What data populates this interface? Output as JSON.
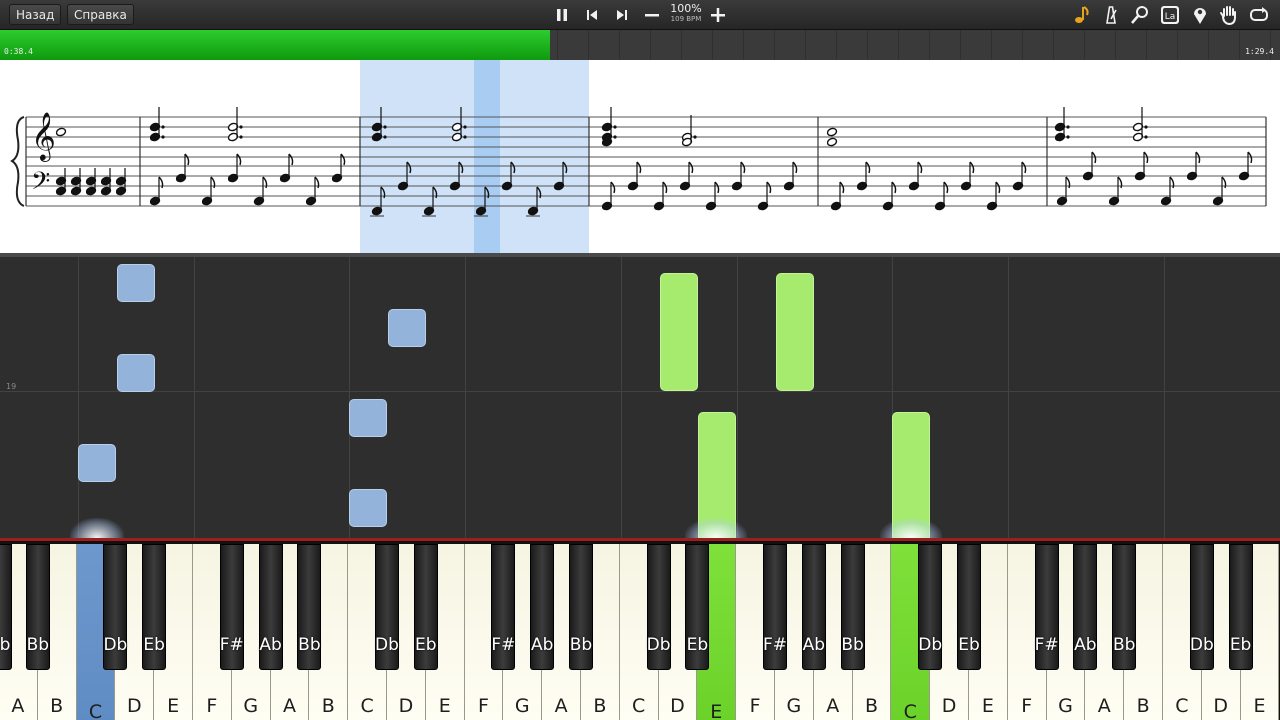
{
  "toolbar": {
    "back_label": "Назад",
    "help_label": "Справка",
    "zoom": "100%",
    "tempo": "109 BPM"
  },
  "progress": {
    "current_time": "0:38.4",
    "total_time": "1:29.4",
    "fraction": 0.43
  },
  "roll": {
    "measure_number": "19"
  },
  "keyboard": {
    "white_keys": [
      "A",
      "B",
      "C",
      "D",
      "E",
      "F",
      "G",
      "A",
      "B",
      "C",
      "D",
      "E",
      "F",
      "G",
      "A",
      "B",
      "C",
      "D",
      "E",
      "F",
      "G",
      "A",
      "B",
      "C",
      "D",
      "E",
      "F",
      "G",
      "A",
      "B",
      "C",
      "D",
      "E"
    ],
    "black_keys": [
      "Bb",
      "Db",
      "Eb",
      "F#",
      "Ab",
      "Bb",
      "Db",
      "Eb",
      "F#",
      "Ab",
      "Bb",
      "Db",
      "Eb",
      "F#",
      "Ab",
      "Bb",
      "Db",
      "Eb",
      "F#",
      "Ab",
      "Bb",
      "Db",
      "Eb"
    ],
    "first_black_partial": "b",
    "highlighted": [
      {
        "key": "C",
        "color": "#5f8cc4"
      },
      {
        "key": "E",
        "color": "#6bd22a"
      },
      {
        "key": "C",
        "color": "#6bd22a"
      }
    ]
  },
  "colors": {
    "left_hand": "#93b3da",
    "right_hand": "#a6ea6e",
    "progress": "#1aa81a",
    "keyboard_border": "#a01d1d"
  }
}
